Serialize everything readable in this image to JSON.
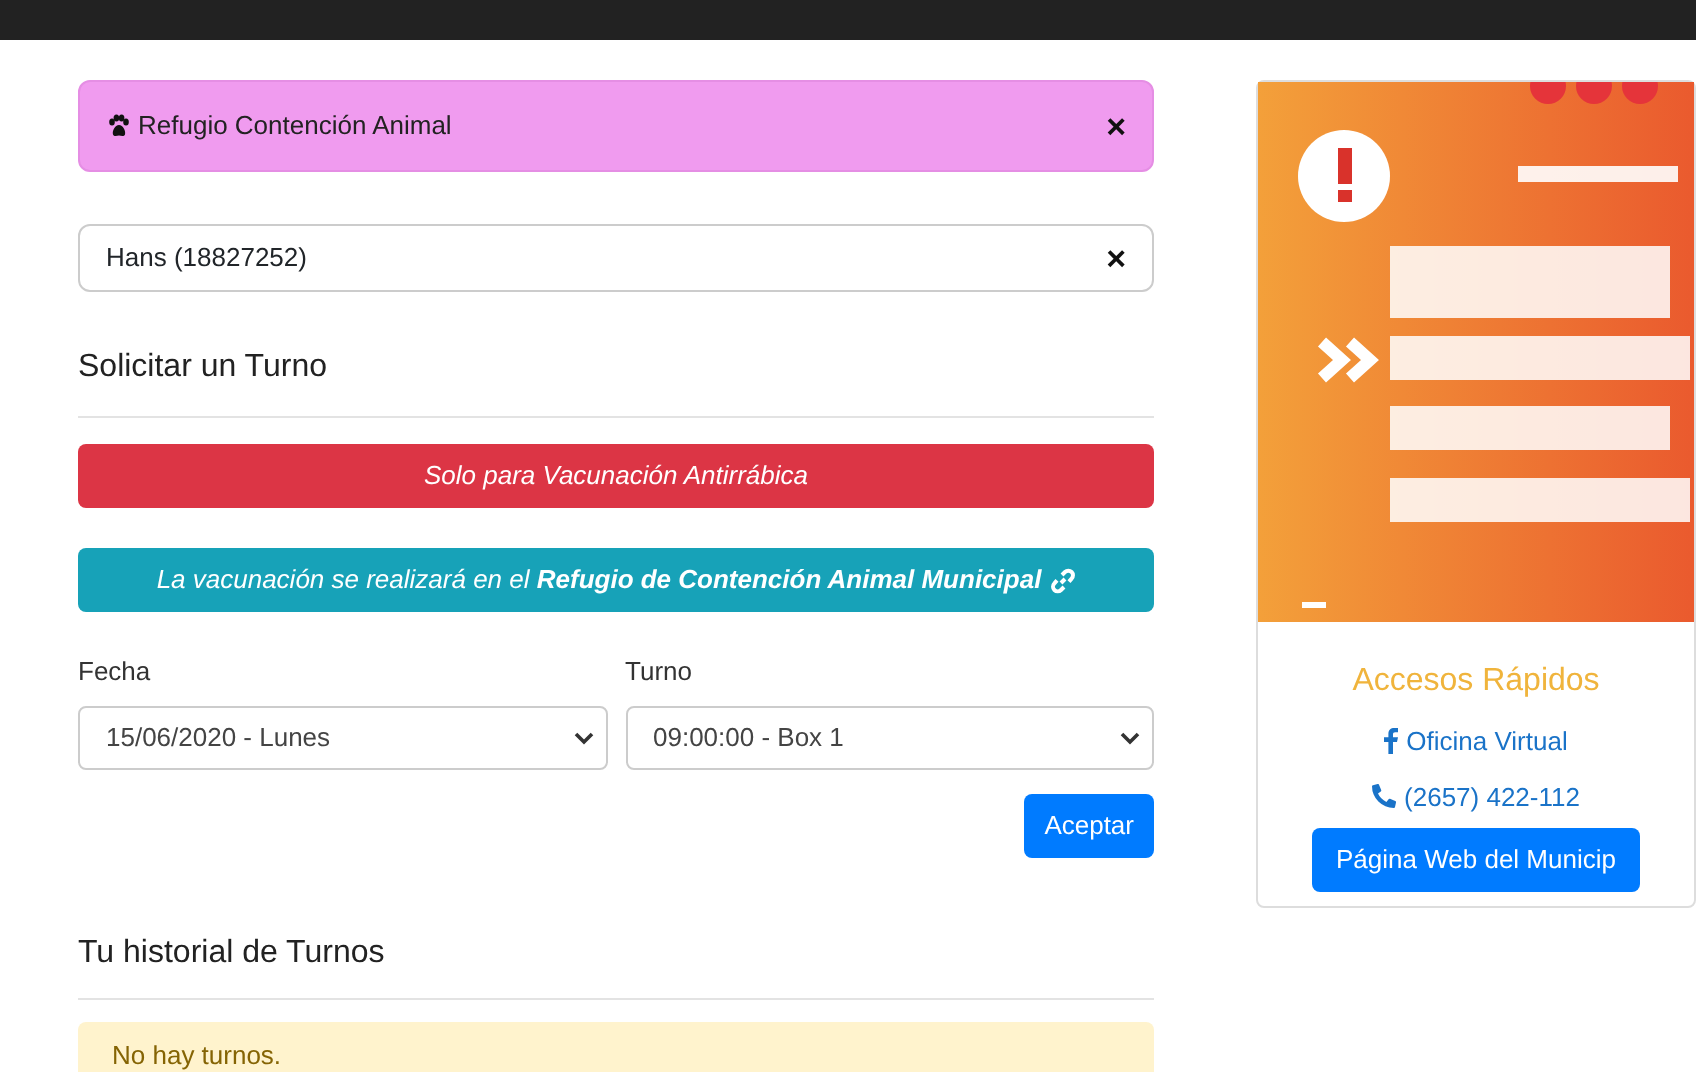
{
  "alert": {
    "text": "Refugio Contención Animal",
    "close": "×"
  },
  "user": {
    "text": "Hans (18827252)",
    "close": "×"
  },
  "form_title": "Solicitar un Turno",
  "notices": [
    {
      "kind": "danger",
      "text": "Solo para Vacunación Antirrábica"
    },
    {
      "kind": "info",
      "text": "La vacunación se realizará en el **Refugio de Contención Animal Municipal**"
    }
  ],
  "fields": [
    {
      "label": "Fecha",
      "value": "15/06/2020 - Lunes"
    },
    {
      "label": "Turno",
      "value": "09:00:00 - Box 1"
    }
  ],
  "submit": "Aceptar",
  "history": {
    "title": "Tu historial de Turnos",
    "empty": "No hay turnos."
  },
  "sidebar": {
    "title": "Accesos Rápidos",
    "links": [
      {
        "kind": "facebook",
        "text": "Oficina Virtual"
      },
      {
        "kind": "phone",
        "text": "(2657) 422-112"
      }
    ],
    "button": "Página Web del Municip"
  }
}
